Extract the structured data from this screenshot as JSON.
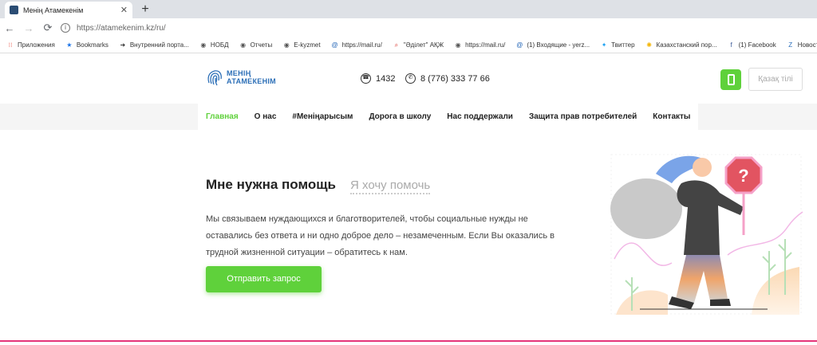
{
  "browser": {
    "tab_title": "Менің Атамекенім",
    "url": "https://atamekenim.kz/ru/",
    "bookmarks": [
      {
        "label": "Приложения",
        "icon": "apps-grid-icon",
        "color": "#e84c3d"
      },
      {
        "label": "Bookmarks",
        "icon": "star-icon",
        "color": "#1a73e8"
      },
      {
        "label": "Внутренний порта...",
        "icon": "portal-icon",
        "color": "#333333"
      },
      {
        "label": "НОБД",
        "icon": "globe-icon",
        "color": "#555555"
      },
      {
        "label": "Отчеты",
        "icon": "globe-icon",
        "color": "#555555"
      },
      {
        "label": "E-kyzmet",
        "icon": "globe-icon",
        "color": "#555555"
      },
      {
        "label": "https://mail.ru/",
        "icon": "mail-icon",
        "color": "#1a5fb4"
      },
      {
        "label": "\"Әділет\" АҚЖ",
        "icon": "search-icon",
        "color": "#d9342b"
      },
      {
        "label": "https://mail.ru/",
        "icon": "globe-icon",
        "color": "#555555"
      },
      {
        "label": "(1) Входящие - yerz...",
        "icon": "mail-icon",
        "color": "#1a5fb4"
      },
      {
        "label": "Твиттер",
        "icon": "twitter-icon",
        "color": "#1da1f2"
      },
      {
        "label": "Казахстанский пор...",
        "icon": "sun-icon",
        "color": "#f4b400"
      },
      {
        "label": "(1) Facebook",
        "icon": "facebook-icon",
        "color": "#3b5998"
      },
      {
        "label": "Новости",
        "icon": "news-icon",
        "color": "#2a6ebb"
      }
    ]
  },
  "header": {
    "logo_line1": "МЕНІҢ",
    "logo_line2": "АТАМЕКЕНІМ",
    "phone_short": "1432",
    "whatsapp": "8 (776) 333 77 66",
    "lang_label": "Қазақ тілі"
  },
  "nav": {
    "items": [
      {
        "label": "Главная",
        "active": true
      },
      {
        "label": "О нас"
      },
      {
        "label": "#Менiңарысым"
      },
      {
        "label": "Дорога в школу"
      },
      {
        "label": "Нас поддержали"
      },
      {
        "label": "Защита прав потребителей"
      },
      {
        "label": "Контакты"
      }
    ]
  },
  "hero": {
    "title_active": "Мне нужна помощь",
    "title_inactive": "Я хочу помочь",
    "description": "Мы связываем нуждающихся и благотворителей, чтобы социальные нужды не оставались без ответа и ни одно доброе дело – незамеченным. Если Вы оказались в трудной жизненной ситуации – обратитесь к нам.",
    "cta_label": "Отправить запрос",
    "sign_symbol": "?"
  },
  "colors": {
    "accent": "#5fd13b",
    "brand_blue": "#2c6fb7",
    "bottom_line": "#e5357a"
  }
}
